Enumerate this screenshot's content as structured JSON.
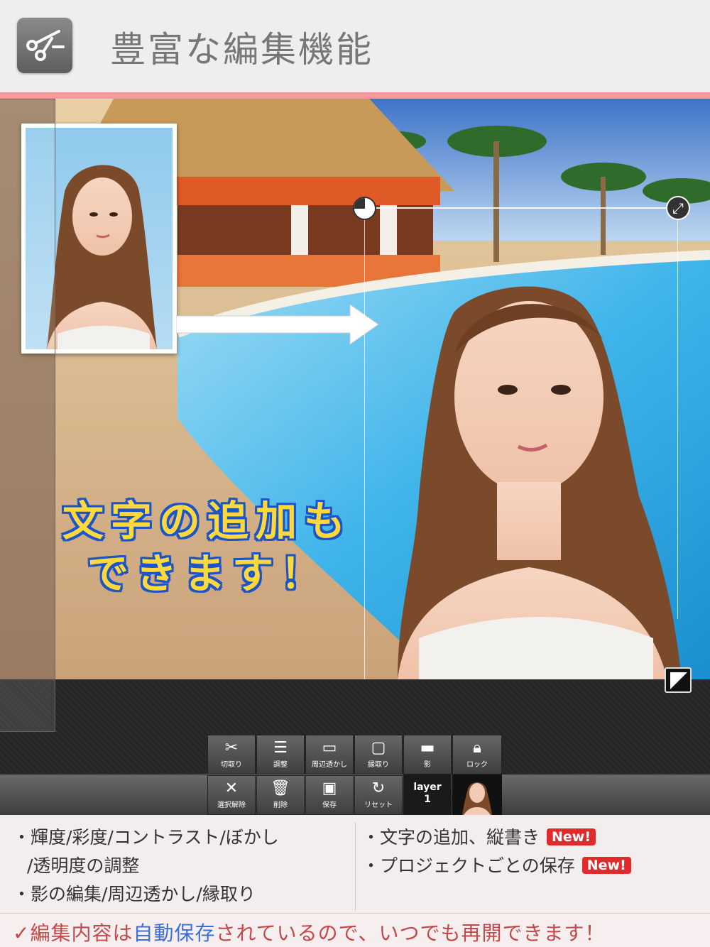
{
  "header": {
    "title": "豊富な編集機能",
    "icon": "scissors-icon"
  },
  "canvas": {
    "overlay_text_line1": "文字の追加も",
    "overlay_text_line2": "できます！"
  },
  "toolbar": {
    "row1": [
      {
        "label": "切取り",
        "icon": "scissors-icon"
      },
      {
        "label": "調整",
        "icon": "sliders-icon"
      },
      {
        "label": "周辺透かし",
        "icon": "vignette-icon"
      },
      {
        "label": "縁取り",
        "icon": "border-icon"
      },
      {
        "label": "影",
        "icon": "shadow-icon"
      },
      {
        "label": "ロック",
        "icon": "lock-icon"
      }
    ],
    "row2": [
      {
        "label": "選択解除",
        "icon": "close-icon"
      },
      {
        "label": "削除",
        "icon": "trash-icon"
      },
      {
        "label": "保存",
        "icon": "save-icon"
      },
      {
        "label": "リセット",
        "icon": "reset-icon"
      }
    ],
    "layer_label": "layer",
    "layer_number": "1"
  },
  "features": {
    "left": [
      "・輝度/彩度/コントラスト/ぼかし",
      "/透明度の調整",
      "・影の編集/周辺透かし/縁取り"
    ],
    "right": [
      {
        "text": "・文字の追加、縦書き",
        "badge": "New!"
      },
      {
        "text": "・プロジェクトごとの保存",
        "badge": "New!"
      }
    ]
  },
  "footer": {
    "check": "✓",
    "pre": "編集内容は",
    "highlight": "自動保存",
    "post": "されているので、いつでも再開できます！"
  },
  "colors": {
    "accent_pink": "#f29b9b",
    "badge_red": "#e12b2b",
    "footer_red": "#c44848",
    "footer_blue": "#3a6fd6",
    "text_yellow": "#ffd93b",
    "text_outline_blue": "#1c55c8"
  }
}
